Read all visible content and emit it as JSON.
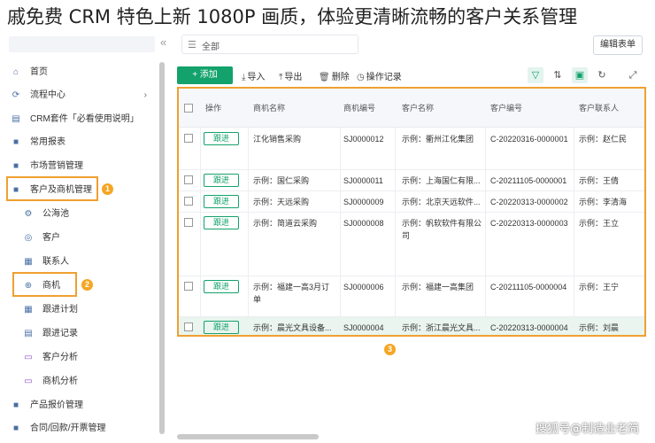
{
  "caption": "戚免费 CRM 特色上新 1080P 画质，体验更清晰流畅的客户关系管理",
  "topbar": {
    "view_select": "全部",
    "collapse_icon": "«",
    "edit_button": "编辑表单"
  },
  "sidebar": {
    "items": [
      {
        "label": "首页",
        "icon": "home-icon"
      },
      {
        "label": "流程中心",
        "icon": "flow-icon",
        "arrow": "›"
      },
      {
        "label": "CRM套件「必看使用说明」",
        "icon": "doc-icon"
      },
      {
        "label": "常用报表",
        "icon": "folder-icon"
      },
      {
        "label": "市场营销管理",
        "icon": "folder-icon"
      },
      {
        "label": "客户及商机管理",
        "icon": "folder-icon"
      },
      {
        "label": "公海池",
        "icon": "pool-icon"
      },
      {
        "label": "客户",
        "icon": "customer-icon"
      },
      {
        "label": "联系人",
        "icon": "contact-icon"
      },
      {
        "label": "商机",
        "icon": "opportunity-icon"
      },
      {
        "label": "跟进计划",
        "icon": "plan-icon"
      },
      {
        "label": "跟进记录",
        "icon": "record-icon"
      },
      {
        "label": "客户分析",
        "icon": "chart-icon"
      },
      {
        "label": "商机分析",
        "icon": "chart-icon"
      },
      {
        "label": "产品报价管理",
        "icon": "folder-icon"
      },
      {
        "label": "合同/回款/开票管理",
        "icon": "folder-icon"
      }
    ],
    "badges": [
      "1",
      "2"
    ]
  },
  "toolbar": {
    "add": "+ 添加",
    "import": "导入",
    "export": "导出",
    "delete": "删除",
    "log": "操作记录"
  },
  "table": {
    "columns": [
      "操作",
      "商机名称",
      "商机编号",
      "客户名称",
      "客户编号",
      "客户联系人"
    ],
    "follow_label": "跟进",
    "rows": [
      {
        "name": "江化销售采购",
        "code": "SJ0000012",
        "customer": "示例：衢州江化集团",
        "cust_code": "C-20220316-0000001",
        "contact": "示例：赵仁民"
      },
      {
        "name": "示例：国仁采购",
        "code": "SJ0000011",
        "customer": "示例：上海国仁有限...",
        "cust_code": "C-20211105-0000001",
        "contact": "示例：王倩"
      },
      {
        "name": "示例：天远采购",
        "code": "SJ0000009",
        "customer": "示例：北京天远软件...",
        "cust_code": "C-20220313-0000002",
        "contact": "示例：李清海"
      },
      {
        "name": "示例：简道云采购",
        "code": "SJ0000008",
        "customer": "示例：帆软软件有限公司",
        "cust_code": "C-20220313-0000003",
        "contact": "示例：王立"
      },
      {
        "name": "示例：福建一高3月订单",
        "code": "SJ0000006",
        "customer": "示例：福建一高集团",
        "cust_code": "C-20211105-0000004",
        "contact": "示例：王宁"
      },
      {
        "name": "示例：晨光文具设备...",
        "code": "SJ0000004",
        "customer": "示例：浙江晨光文具...",
        "cust_code": "C-20220313-0000004",
        "contact": "示例：刘晨"
      }
    ],
    "badge": "3"
  },
  "watermark": "搜狐号@制造业老简"
}
